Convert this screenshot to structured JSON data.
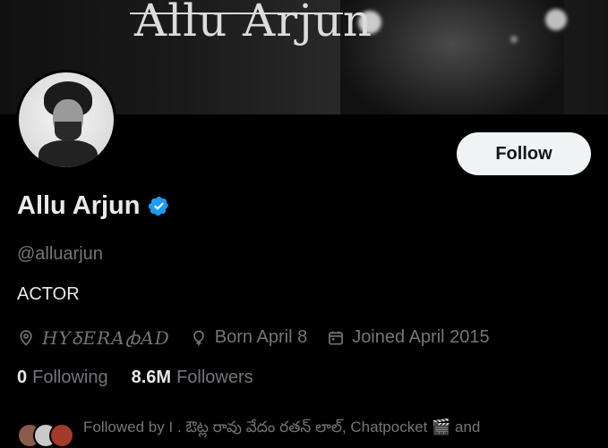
{
  "banner": {
    "signature_text": "Allu Arjun"
  },
  "profile": {
    "name": "Allu Arjun",
    "handle": "@alluarjun",
    "bio": "ACTOR",
    "location": "HYꝽERAꞗAD",
    "born": "Born April 8",
    "joined": "Joined April 2015",
    "following_count": "0",
    "following_label": "Following",
    "followers_count": "8.6M",
    "followers_label": "Followers",
    "followed_by": "Followed by I . ఔట్ల రావు వేదం రతన్ లాల్, Chatpocket 🎬 and"
  },
  "actions": {
    "follow_label": "Follow"
  },
  "colors": {
    "background": "#000000",
    "primary_text": "#e7e9ea",
    "secondary_text": "#71767b",
    "verified_blue": "#1d9bf0",
    "button_bg": "#eff3f4"
  },
  "icons": {
    "location": "map-pin-icon",
    "birthday": "balloon-icon",
    "joined": "calendar-icon",
    "verified": "verified-badge-icon"
  }
}
